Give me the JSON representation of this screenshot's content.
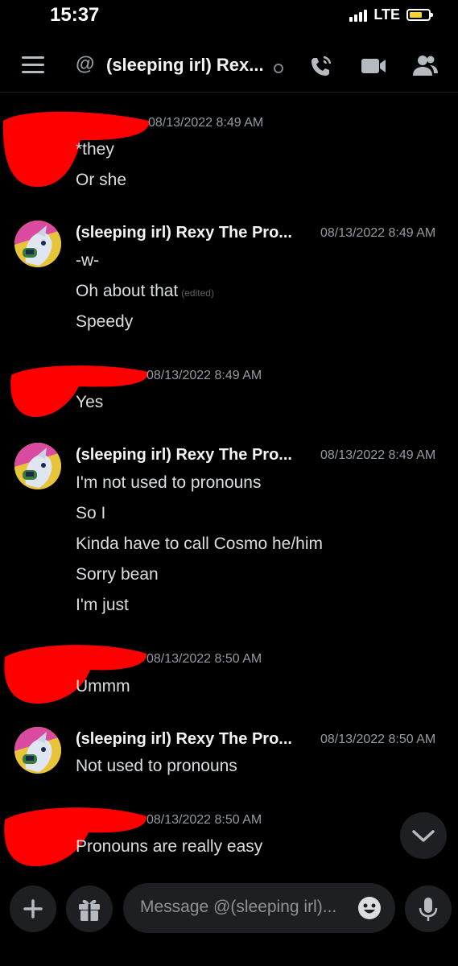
{
  "status_bar": {
    "time": "15:37",
    "network": "LTE"
  },
  "header": {
    "at_symbol": "@",
    "title": "(sleeping irl) Rex...",
    "icons": [
      "menu-icon",
      "at-icon",
      "call-icon",
      "video-icon",
      "members-icon"
    ]
  },
  "messages": [
    {
      "author": "",
      "timestamp": "08/13/2022 8:49 AM",
      "lines": [
        "*they",
        "Or she"
      ]
    },
    {
      "author": "(sleeping irl) Rexy The Pro...",
      "timestamp": "08/13/2022 8:49 AM",
      "lines": [
        "-w-",
        "Oh about that",
        "Speedy"
      ],
      "edited": "(edited)"
    },
    {
      "author": "",
      "timestamp": "08/13/2022 8:49 AM",
      "lines": [
        "Yes"
      ]
    },
    {
      "author": "(sleeping irl) Rexy The Pro...",
      "timestamp": "08/13/2022 8:49 AM",
      "lines": [
        "I'm not used to pronouns",
        "So I",
        "Kinda have to call Cosmo he/him",
        "Sorry bean",
        "I'm just"
      ]
    },
    {
      "author": "",
      "timestamp": "08/13/2022 8:50 AM",
      "lines": [
        "Ummm"
      ]
    },
    {
      "author": "(sleeping irl) Rexy The Pro...",
      "timestamp": "08/13/2022 8:50 AM",
      "lines": [
        "Not used to pronouns"
      ]
    },
    {
      "author": "",
      "timestamp": "08/13/2022 8:50 AM",
      "lines": [
        "Pronouns are really easy"
      ]
    }
  ],
  "composer": {
    "placeholder": "Message @(sleeping irl)..."
  },
  "colors": {
    "background": "#000000",
    "redaction": "#ff0000",
    "avatar_bg": "#e8c43a"
  }
}
